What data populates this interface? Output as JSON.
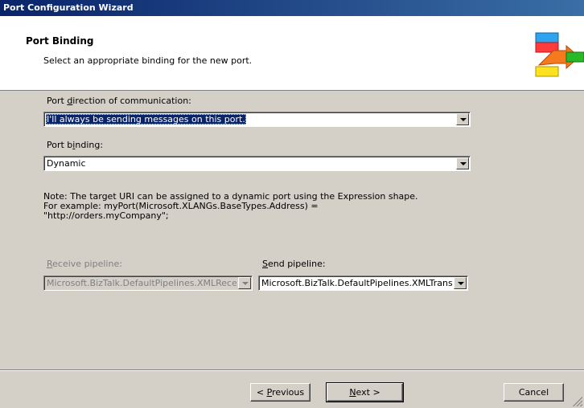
{
  "window": {
    "title": "Port Configuration Wizard"
  },
  "header": {
    "title": "Port Binding",
    "subtitle": "Select an appropriate binding for the new port.",
    "icon": "port-wizard-icon"
  },
  "direction": {
    "label_before": "Port ",
    "label_accel": "d",
    "label_after": "irection of communication:",
    "value": "I'll always be sending messages on this port."
  },
  "binding": {
    "label_before": "Port b",
    "label_accel": "i",
    "label_after": "nding:",
    "value": "Dynamic"
  },
  "note": {
    "line1": "Note: The target URI can be assigned to a dynamic port using the Expression shape.",
    "line2": "For example: myPort(Microsoft.XLANGs.BaseTypes.Address) =",
    "line3": "\"http://orders.myCompany\";"
  },
  "receive_pipeline": {
    "label_accel": "R",
    "label_after": "eceive pipeline:",
    "value": "Microsoft.BizTalk.DefaultPipelines.XMLReceive",
    "enabled": false
  },
  "send_pipeline": {
    "label_accel": "S",
    "label_after": "end pipeline:",
    "value": "Microsoft.BizTalk.DefaultPipelines.XMLTransmit",
    "enabled": true
  },
  "buttons": {
    "previous_prefix": "< ",
    "previous_accel": "P",
    "previous_rest": "revious",
    "next_accel": "N",
    "next_rest": "ext >",
    "cancel": "Cancel"
  },
  "colors": {
    "title_bar": "#0a246a",
    "face": "#d4d0c8",
    "selection": "#0a246a"
  }
}
